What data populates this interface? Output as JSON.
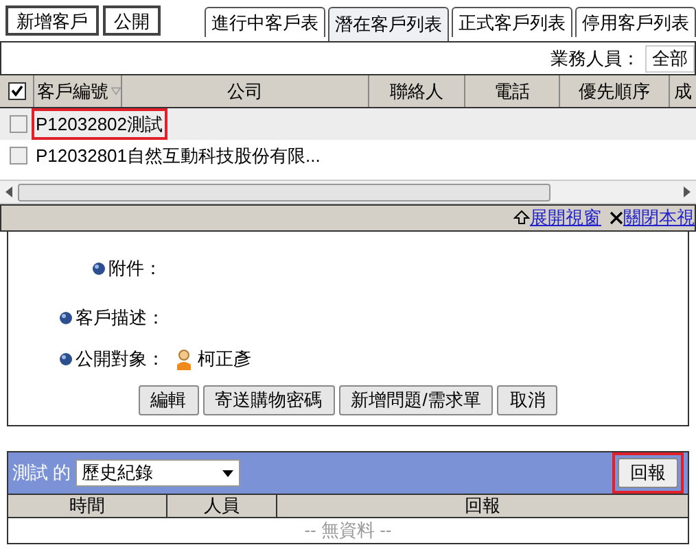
{
  "toolbar": {
    "buttons": [
      "新增客戶",
      "公開"
    ]
  },
  "tabs": [
    {
      "label": "進行中客戶表",
      "selected": false
    },
    {
      "label": "潛在客戶列表",
      "selected": true
    },
    {
      "label": "正式客戶列表",
      "selected": false
    },
    {
      "label": "停用客戶列表",
      "selected": false
    }
  ],
  "filter": {
    "label": "業務人員：",
    "value": "全部"
  },
  "table": {
    "select_all_checked": true,
    "columns": [
      "客戶編號",
      "公司",
      "聯絡人",
      "電話",
      "優先順序",
      "成"
    ],
    "rows": [
      {
        "text": "P12032802測試",
        "checked": false,
        "selected": true,
        "highlighted": true
      },
      {
        "text": "P12032801自然互動科技股份有限...",
        "checked": false,
        "selected": false,
        "highlighted": false
      }
    ]
  },
  "panel_links": [
    "展開視窗",
    "關閉本視"
  ],
  "details": [
    {
      "label": "附件："
    },
    {
      "label": "客戶描述："
    },
    {
      "label": "公開對象：",
      "person": "柯正彥"
    }
  ],
  "detail_buttons": [
    "編輯",
    "寄送購物密碼",
    "新增問題/需求單",
    "取消"
  ],
  "history": {
    "title": "測試 的",
    "select": "歷史紀錄",
    "button": "回報",
    "button_highlighted": true,
    "columns": [
      "時間",
      "人員",
      "回報"
    ],
    "empty": "-- 無資料 --"
  }
}
